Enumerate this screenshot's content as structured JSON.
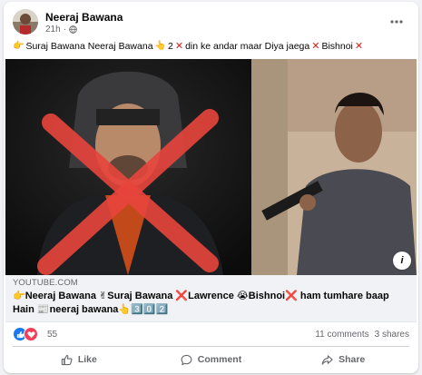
{
  "post": {
    "author": "Neeraj Bawana",
    "time": "21h",
    "text_parts": [
      "Suraj Bawana Neeraj Bawana",
      "2",
      "din ke andar maar Diya jaega",
      "Bishnoi"
    ],
    "more_icon": "more-horizontal-icon",
    "privacy_icon": "globe-icon"
  },
  "link": {
    "domain": "YOUTUBE.COM",
    "title_line1": "👉Neeraj Bawana ✌Suraj Bawana ❌Lawrence 😭Bishnoi❌ ham tumhare baap",
    "title_line2": "Hain 📰neeraj bawana👆3️⃣0️⃣2️⃣",
    "info_label": "i"
  },
  "reactions": {
    "count": "55",
    "comments": "11 comments",
    "shares": "3 shares"
  },
  "actions": {
    "like": "Like",
    "comment": "Comment",
    "share": "Share"
  },
  "colors": {
    "like_blue": "#1877f2",
    "love_red": "#f33e58",
    "cross_red": "#e8453c"
  }
}
